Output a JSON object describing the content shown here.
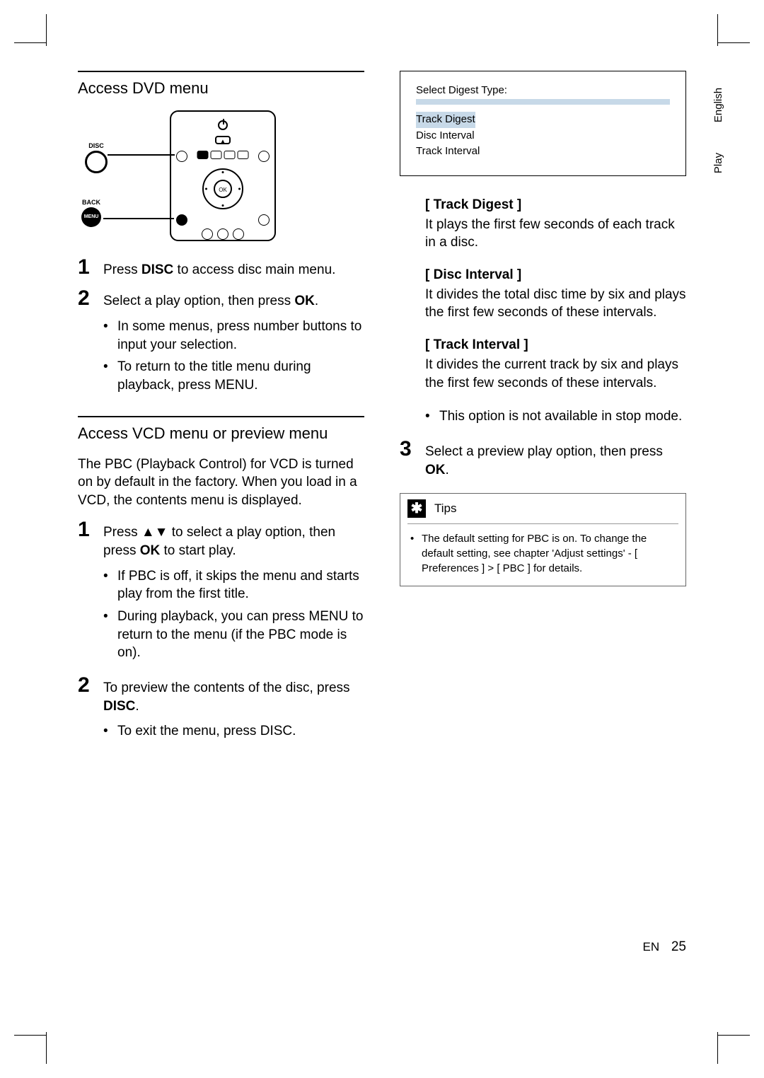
{
  "side_tabs": {
    "lang": "English",
    "section": "Play"
  },
  "left": {
    "dvd": {
      "title": "Access DVD menu",
      "diagram": {
        "disc_label": "DISC",
        "back_label": "BACK",
        "menu_label": "MENU",
        "ok_label": "OK",
        "eject_triangle": "▲"
      },
      "steps": [
        {
          "num": "1",
          "text_pre": "Press ",
          "bold1": "DISC",
          "text_post": " to access disc main menu."
        },
        {
          "num": "2",
          "text_pre": "Select a play option, then press ",
          "bold1": "OK",
          "text_post": "."
        }
      ],
      "bullets": [
        {
          "text_pre": "In some menus, press ",
          "bold1": "number buttons",
          "text_post": " to input your selection."
        },
        {
          "text_pre": "To return to the title menu during playback, press ",
          "bold1": "MENU",
          "text_post": "."
        }
      ]
    },
    "vcd": {
      "title": "Access VCD menu or preview menu",
      "intro": "The PBC (Playback Control) for VCD is turned on by default in the factory.  When you load in a VCD, the contents menu is displayed.",
      "steps": [
        {
          "num": "1",
          "text_pre": "Press ",
          "sym": "▲▼",
          "text_mid": " to select a play option, then press ",
          "bold1": "OK",
          "text_post": " to start play."
        },
        {
          "num": "2",
          "text_pre": "To preview the contents of the disc, press ",
          "bold1": "DISC",
          "text_post": "."
        }
      ],
      "bullets1": [
        {
          "text": "If PBC is off, it skips the menu and starts play from the first title."
        },
        {
          "text_pre": "During playback, you can press ",
          "bold1": "MENU",
          "text_post": " to return to the menu (if the PBC mode is on)."
        }
      ],
      "bullets2": [
        {
          "text_pre": "To exit the menu, press ",
          "bold1": "DISC",
          "text_post": "."
        }
      ]
    }
  },
  "right": {
    "digest_box": {
      "header": "Select Digest Type:",
      "items": [
        "Track Digest",
        "Disc Interval",
        "Track Interval"
      ]
    },
    "options": [
      {
        "title": "[ Track Digest ]",
        "text": "It plays the first few seconds of each track in a disc."
      },
      {
        "title": "[ Disc Interval ]",
        "text": "It divides the total disc time by six and plays the first few seconds of these intervals."
      },
      {
        "title": "[ Track Interval ]",
        "text": "It divides the current track by six and plays the first few seconds of these intervals."
      }
    ],
    "option_bullet": "This option is not available in stop mode.",
    "step3": {
      "num": "3",
      "text_pre": "Select a preview play option, then press ",
      "bold1": "OK",
      "text_post": "."
    },
    "tips": {
      "label": "Tips",
      "text_pre": "The default setting for PBC is on.  To change the default setting, see chapter 'Adjust settings' - ",
      "bold1": "[ Preferences ]",
      "mid": " > ",
      "bold2": "[ PBC ]",
      "text_post": " for details."
    }
  },
  "footer": {
    "lang": "EN",
    "page": "25"
  }
}
